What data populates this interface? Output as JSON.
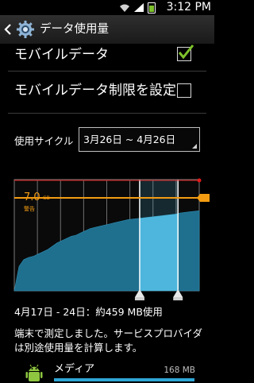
{
  "status_bar": {
    "time": "3:12 PM"
  },
  "action_bar": {
    "title": "データ使用量"
  },
  "settings": {
    "mobile_data": {
      "label": "モバイルデータ",
      "checked": true
    },
    "mobile_data_limit": {
      "label": "モバイルデータ制限を設定",
      "checked": false
    }
  },
  "cycle": {
    "label": "使用サイクル",
    "value": "3月26日 ~ 4月26日"
  },
  "chart_data": {
    "type": "area",
    "warning": {
      "value": 7.0,
      "value_label": "7.0",
      "unit_label": "GB",
      "label": "警告",
      "color": "#f39c12"
    },
    "limit_color": "#e11b1b",
    "series": [
      {
        "values": [
          0,
          0.22,
          0.28,
          0.3,
          0.31,
          0.33,
          0.35,
          0.37,
          0.4,
          0.43,
          0.45,
          0.47,
          0.49,
          0.5,
          0.52,
          0.54,
          0.56,
          0.57,
          0.58,
          0.59,
          0.6,
          0.61,
          0.62,
          0.63,
          0.64,
          0.645,
          0.65,
          0.655,
          0.66,
          0.665,
          0.67,
          0.675,
          0.68,
          0.685,
          0.69,
          0.7,
          0.705,
          0.71,
          0.715,
          0.72
        ]
      }
    ],
    "selection": {
      "start": 0.678,
      "end": 0.885
    },
    "fill_color": "#1f6f8e",
    "selection_color": "#4eb6dc",
    "grid": true
  },
  "summary": {
    "text": "4月17日 - 24日：約459 MB使用"
  },
  "note": {
    "text": "端末で測定しました。サービスプロバイダは別途使用量を計算します。"
  },
  "apps": [
    {
      "name": "メディア",
      "size": "168 MB",
      "icon": "android-icon"
    }
  ]
}
